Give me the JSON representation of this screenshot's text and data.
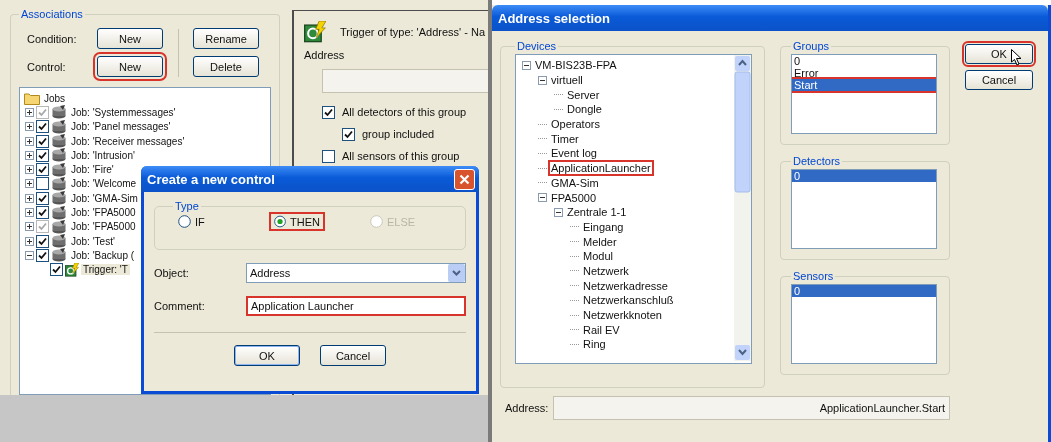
{
  "left_window": {
    "associations": {
      "title": "Associations",
      "rows": [
        {
          "label": "Condition:",
          "buttons": [
            {
              "label": "New",
              "highlighted": false
            },
            {
              "label": "Rename",
              "highlighted": false
            }
          ]
        },
        {
          "label": "Control:",
          "buttons": [
            {
              "label": "New",
              "highlighted": true
            },
            {
              "label": "Delete",
              "highlighted": false
            }
          ]
        }
      ],
      "tree": {
        "root": "Jobs",
        "items": [
          {
            "kind": "job",
            "label": "Job: 'Systemmessages'",
            "checked": true,
            "dimmed": true,
            "expanded": false,
            "selected": false
          },
          {
            "kind": "job",
            "label": "Job: 'Panel messages'",
            "checked": true,
            "dimmed": false,
            "expanded": false,
            "selected": false
          },
          {
            "kind": "job",
            "label": "Job: 'Receiver messages'",
            "checked": true,
            "dimmed": false,
            "expanded": false,
            "selected": false
          },
          {
            "kind": "job",
            "label": "Job: 'Intrusion'",
            "checked": true,
            "dimmed": false,
            "expanded": false,
            "selected": false
          },
          {
            "kind": "job",
            "label": "Job: 'Fire'",
            "checked": true,
            "dimmed": false,
            "expanded": false,
            "selected": false
          },
          {
            "kind": "job",
            "label": "Job: 'Welcome",
            "checked": false,
            "dimmed": false,
            "expanded": false,
            "selected": false
          },
          {
            "kind": "job",
            "label": "Job: 'GMA-Sim",
            "checked": true,
            "dimmed": false,
            "expanded": false,
            "selected": false
          },
          {
            "kind": "job",
            "label": "Job: 'FPA5000",
            "checked": true,
            "dimmed": false,
            "expanded": false,
            "selected": false
          },
          {
            "kind": "job",
            "label": "Job: 'FPA5000",
            "checked": true,
            "dimmed": true,
            "expanded": false,
            "selected": false
          },
          {
            "kind": "job",
            "label": "Job: 'Test'",
            "checked": true,
            "dimmed": false,
            "expanded": false,
            "selected": false
          },
          {
            "kind": "job",
            "label": "Job: 'Backup (",
            "checked": true,
            "dimmed": false,
            "expanded": true,
            "selected": false,
            "children": [
              {
                "kind": "trigger",
                "label": "Trigger: 'T",
                "checked": true,
                "dimmed": false,
                "selected": true
              }
            ]
          }
        ]
      }
    },
    "trigger_pane": {
      "heading": "Trigger of type: 'Address' - Na",
      "address_label": "Address",
      "checkboxes": [
        {
          "label": "All detectors of this group",
          "checked": true,
          "children": [
            {
              "label": "group included",
              "checked": true
            }
          ]
        },
        {
          "label": "All sensors of this group",
          "checked": false
        }
      ]
    }
  },
  "create_dialog": {
    "title": "Create a new control",
    "type_group": {
      "title": "Type",
      "options": [
        {
          "label": "IF",
          "selected": false,
          "disabled": false,
          "highlighted": false
        },
        {
          "label": "THEN",
          "selected": true,
          "disabled": false,
          "highlighted": true
        },
        {
          "label": "ELSE",
          "selected": false,
          "disabled": true,
          "highlighted": false
        }
      ]
    },
    "object": {
      "label": "Object:",
      "value": "Address"
    },
    "comment": {
      "label": "Comment:",
      "value": "Application Launcher",
      "highlighted": true
    },
    "buttons": [
      {
        "label": "OK",
        "default": true
      },
      {
        "label": "Cancel",
        "default": false
      }
    ]
  },
  "address_dialog": {
    "title": "Address selection",
    "devices": {
      "title": "Devices",
      "tree": [
        {
          "label": "VM-BIS23B-FPA",
          "expanded": true,
          "highlighted": false,
          "children": [
            {
              "label": "virtuell",
              "expanded": true,
              "highlighted": false,
              "children": [
                {
                  "label": "Server",
                  "highlighted": false
                },
                {
                  "label": "Dongle",
                  "highlighted": false
                }
              ]
            },
            {
              "label": "Operators",
              "highlighted": false
            },
            {
              "label": "Timer",
              "highlighted": false
            },
            {
              "label": "Event log",
              "highlighted": false
            },
            {
              "label": "ApplicationLauncher",
              "highlighted": true
            },
            {
              "label": "GMA-Sim",
              "highlighted": false
            },
            {
              "label": "FPA5000",
              "expanded": true,
              "highlighted": false,
              "children": [
                {
                  "label": "Zentrale 1-1",
                  "expanded": true,
                  "highlighted": false,
                  "children": [
                    {
                      "label": "Eingang",
                      "highlighted": false
                    },
                    {
                      "label": "Melder",
                      "highlighted": false
                    },
                    {
                      "label": "Modul",
                      "highlighted": false
                    },
                    {
                      "label": "Netzwerk",
                      "highlighted": false
                    },
                    {
                      "label": "Netzwerkadresse",
                      "highlighted": false
                    },
                    {
                      "label": "Netzwerkanschluß",
                      "highlighted": false
                    },
                    {
                      "label": "Netzwerkknoten",
                      "highlighted": false
                    },
                    {
                      "label": "Rail EV",
                      "highlighted": false
                    },
                    {
                      "label": "Ring",
                      "highlighted": false
                    }
                  ]
                }
              ]
            }
          ]
        }
      ]
    },
    "lists": [
      {
        "title": "Groups",
        "items": [
          {
            "label": "0",
            "selected": false,
            "highlighted": false
          },
          {
            "label": "Error",
            "selected": false,
            "highlighted": false
          },
          {
            "label": "Start",
            "selected": true,
            "highlighted": true
          }
        ]
      },
      {
        "title": "Detectors",
        "items": [
          {
            "label": "0",
            "selected": true,
            "highlighted": false
          }
        ]
      },
      {
        "title": "Sensors",
        "items": [
          {
            "label": "0",
            "selected": true,
            "highlighted": false
          }
        ]
      }
    ],
    "address": {
      "label": "Address:",
      "value": "ApplicationLauncher.Start"
    },
    "buttons": [
      {
        "label": "OK",
        "highlighted": true
      },
      {
        "label": "Cancel",
        "highlighted": false
      }
    ]
  }
}
